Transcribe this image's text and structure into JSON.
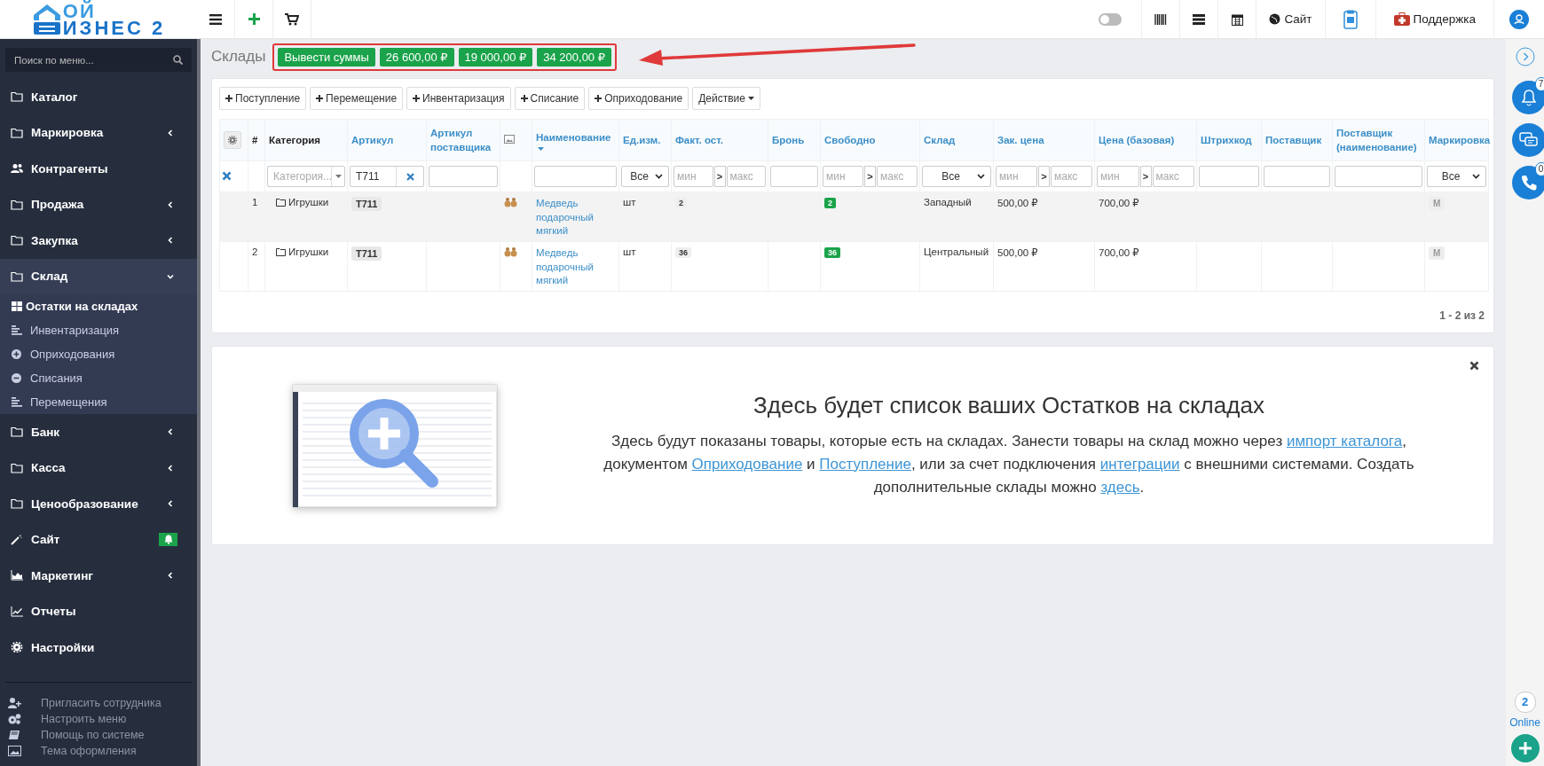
{
  "logo": {
    "line1": "ОЙ",
    "line2": "ИЗНЕС 2"
  },
  "topbar": {
    "site_label": "Сайт",
    "support_label": "Поддержка",
    "toggle_on": false
  },
  "sidebar": {
    "search_placeholder": "Поиск по меню...",
    "items": [
      {
        "label": "Каталог",
        "expandable": false,
        "expanded": false,
        "alert": false
      },
      {
        "label": "Маркировка",
        "expandable": true,
        "expanded": false,
        "alert": false
      },
      {
        "label": "Контрагенты",
        "expandable": false,
        "expanded": false,
        "alert": false
      },
      {
        "label": "Продажа",
        "expandable": true,
        "expanded": false,
        "alert": false
      },
      {
        "label": "Закупка",
        "expandable": true,
        "expanded": false,
        "alert": false
      },
      {
        "label": "Склад",
        "expandable": true,
        "expanded": true,
        "alert": false,
        "children": [
          {
            "label": "Остатки на складах",
            "selected": true
          },
          {
            "label": "Инвентаризация",
            "selected": false
          },
          {
            "label": "Оприходования",
            "selected": false
          },
          {
            "label": "Списания",
            "selected": false
          },
          {
            "label": "Перемещения",
            "selected": false
          }
        ]
      },
      {
        "label": "Банк",
        "expandable": true,
        "expanded": false,
        "alert": false
      },
      {
        "label": "Касса",
        "expandable": true,
        "expanded": false,
        "alert": false
      },
      {
        "label": "Ценообразование",
        "expandable": true,
        "expanded": false,
        "alert": false
      },
      {
        "label": "Сайт",
        "expandable": false,
        "expanded": false,
        "alert": true
      },
      {
        "label": "Маркетинг",
        "expandable": true,
        "expanded": false,
        "alert": false
      },
      {
        "label": "Отчеты",
        "expandable": false,
        "expanded": false,
        "alert": false
      },
      {
        "label": "Настройки",
        "expandable": false,
        "expanded": false,
        "alert": false
      }
    ],
    "footer": [
      "Пригласить сотрудника",
      "Настроить меню",
      "Помощь по системе",
      "Тема оформления"
    ]
  },
  "page": {
    "title": "Склады",
    "sums_button": "Вывести суммы",
    "sums": [
      "26 600,00 ₽",
      "19 000,00 ₽",
      "34 200,00 ₽"
    ]
  },
  "toolbar": {
    "buttons": [
      "Поступление",
      "Перемещение",
      "Инвентаризация",
      "Списание",
      "Оприходование"
    ],
    "action": "Действие"
  },
  "table": {
    "columns": [
      {
        "kind": "settings"
      },
      {
        "kind": "text",
        "label": "#",
        "sortable": false,
        "sorted": false
      },
      {
        "kind": "text",
        "label": "Категория",
        "sortable": false,
        "sorted": false
      },
      {
        "kind": "text",
        "label": "Артикул",
        "sortable": true,
        "sorted": false
      },
      {
        "kind": "text",
        "label": "Артикул поставщика",
        "sortable": true,
        "sorted": false
      },
      {
        "kind": "image"
      },
      {
        "kind": "text",
        "label": "Наименование",
        "sortable": true,
        "sorted": true
      },
      {
        "kind": "text",
        "label": "Ед.изм.",
        "sortable": true,
        "sorted": false
      },
      {
        "kind": "text",
        "label": "Факт. ост.",
        "sortable": true,
        "sorted": false
      },
      {
        "kind": "text",
        "label": "Бронь",
        "sortable": true,
        "sorted": false
      },
      {
        "kind": "text",
        "label": "Свободно",
        "sortable": true,
        "sorted": false
      },
      {
        "kind": "text",
        "label": "Склад",
        "sortable": true,
        "sorted": false
      },
      {
        "kind": "text",
        "label": "Зак. цена",
        "sortable": true,
        "sorted": false
      },
      {
        "kind": "text",
        "label": "Цена (базовая)",
        "sortable": true,
        "sorted": false
      },
      {
        "kind": "text",
        "label": "Штрихкод",
        "sortable": true,
        "sorted": false
      },
      {
        "kind": "text",
        "label": "Поставщик",
        "sortable": true,
        "sorted": false
      },
      {
        "kind": "text",
        "label": "Поставщик (наименование)",
        "sortable": true,
        "sorted": false
      },
      {
        "kind": "text",
        "label": "Маркировка",
        "sortable": true,
        "sorted": false
      }
    ],
    "filters": [
      {
        "kind": "clear"
      },
      {
        "kind": "none"
      },
      {
        "kind": "combo",
        "placeholder": "Категория..."
      },
      {
        "kind": "text-clear",
        "value": "T711"
      },
      {
        "kind": "text"
      },
      {
        "kind": "none"
      },
      {
        "kind": "text"
      },
      {
        "kind": "select",
        "value": "Все"
      },
      {
        "kind": "range",
        "min": "мин",
        "sep": ">",
        "max": "макс"
      },
      {
        "kind": "text"
      },
      {
        "kind": "range",
        "min": "мин",
        "sep": ">",
        "max": "макс"
      },
      {
        "kind": "select",
        "value": "Все"
      },
      {
        "kind": "range",
        "min": "мин",
        "sep": ">",
        "max": "макс"
      },
      {
        "kind": "range",
        "min": "мин",
        "sep": ">",
        "max": "макс"
      },
      {
        "kind": "text"
      },
      {
        "kind": "text"
      },
      {
        "kind": "text"
      },
      {
        "kind": "select",
        "value": "Все"
      }
    ],
    "rows": [
      {
        "num": "1",
        "category": "Игрушки",
        "article": "T711",
        "name": "Медведь подарочный мягкий",
        "unit": "шт",
        "fact": "2",
        "free": "2",
        "warehouse": "Западный",
        "purchase_price": "500,00 ₽",
        "base_price": "700,00 ₽",
        "marking": "М",
        "highlighted": true
      },
      {
        "num": "2",
        "category": "Игрушки",
        "article": "T711",
        "name": "Медведь подарочный мягкий",
        "unit": "шт",
        "fact": "36",
        "free": "36",
        "warehouse": "Центральный",
        "purchase_price": "500,00 ₽",
        "base_price": "700,00 ₽",
        "marking": "М",
        "highlighted": false
      }
    ],
    "pagination": "1 - 2 из 2"
  },
  "info": {
    "title": "Здесь будет список ваших Остатков на складах",
    "parts": [
      {
        "kind": "text",
        "text": "Здесь будут показаны товары, которые есть на складах. Занести товары на склад можно через "
      },
      {
        "kind": "link",
        "text": "импорт каталога"
      },
      {
        "kind": "text",
        "text": ", документом "
      },
      {
        "kind": "link",
        "text": "Оприходование"
      },
      {
        "kind": "text",
        "text": " и "
      },
      {
        "kind": "link",
        "text": "Поступление"
      },
      {
        "kind": "text",
        "text": ", или за счет подключения "
      },
      {
        "kind": "link",
        "text": "интеграции"
      },
      {
        "kind": "text",
        "text": " с внешними системами. Создать дополнительные склады можно "
      },
      {
        "kind": "link",
        "text": "здесь"
      },
      {
        "kind": "text",
        "text": "."
      }
    ]
  },
  "rail": {
    "notifications": "7",
    "calls": "0",
    "online_count": "2",
    "online_label": "Online"
  }
}
